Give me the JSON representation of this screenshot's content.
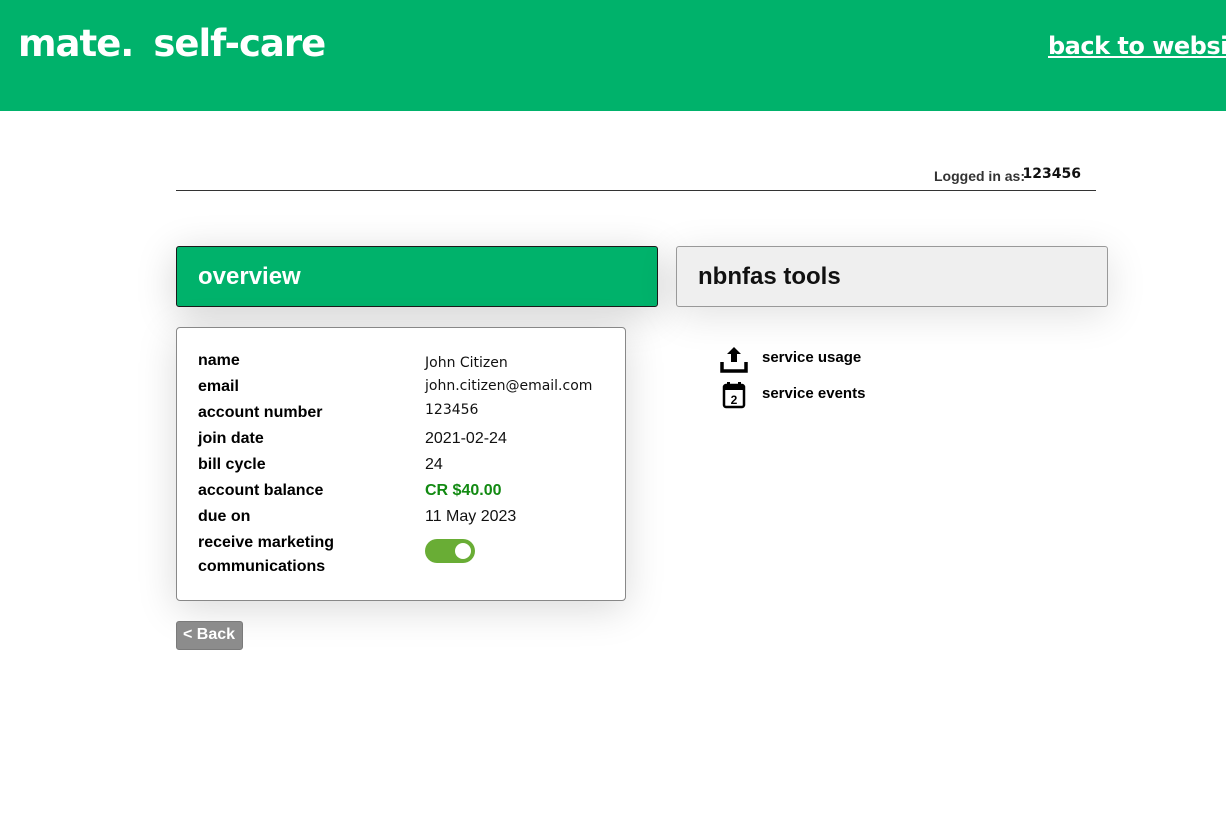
{
  "header": {
    "brand": "mate.",
    "product": "self-care",
    "back_link": "back to website"
  },
  "session": {
    "logged_in_label": "Logged in as:",
    "user_id": "123456"
  },
  "tabs": {
    "overview": "overview",
    "tools": "nbnfas tools"
  },
  "account": {
    "name_label": "name",
    "name_value": "John Citizen",
    "email_label": "email",
    "email_value": "john.citizen@email.com",
    "number_label": "account number",
    "number_value": "123456",
    "join_label": "join date",
    "join_value": "2021-02-24",
    "cycle_label": "bill cycle",
    "cycle_value": "24",
    "balance_label": "account balance",
    "balance_value": "CR $40.00",
    "due_label": "due on",
    "due_value": "11 May 2023",
    "marketing_label_1": "receive marketing",
    "marketing_label_2": "communications",
    "marketing_enabled": true
  },
  "back_button": "< Back",
  "tools": [
    {
      "icon": "upload-icon",
      "label": "service usage"
    },
    {
      "icon": "calendar-icon",
      "label": "service events",
      "icon_number": "2"
    }
  ],
  "colors": {
    "brand_green": "#00b26b",
    "balance_green": "#128a12",
    "toggle_green": "#69ad35",
    "back_grey": "#8c8c8c"
  }
}
